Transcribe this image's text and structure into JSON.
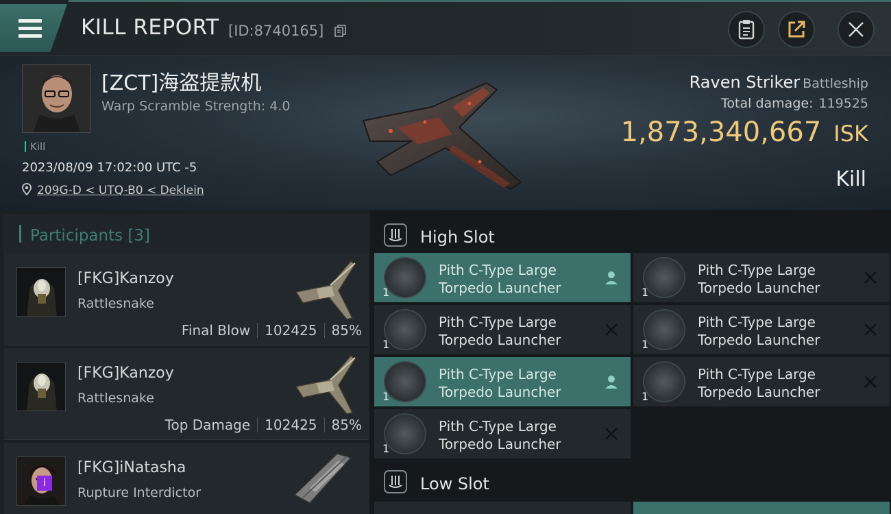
{
  "header": {
    "title": "KILL REPORT",
    "report_id": "[ID:8740165]"
  },
  "victim": {
    "name": "[ZCT]海盗提款机",
    "warp_scramble": "Warp Scramble Strength: 4.0",
    "tag": "Kill",
    "datetime": "2023/08/09 17:02:00 UTC -5",
    "location": "209G-D < UTQ-B0 < Deklein",
    "ship_name": "Raven Striker",
    "ship_class": "Battleship",
    "total_damage_label": "Total damage:",
    "total_damage": "119525",
    "isk_value": "1,873,340,667",
    "isk_unit": "ISK",
    "result": "Kill"
  },
  "participants": {
    "label": "Participants [3]",
    "items": [
      {
        "name": "[FKG]Kanzoy",
        "ship": "Rattlesnake",
        "role": "Final Blow",
        "damage": "102425",
        "percent": "85%"
      },
      {
        "name": "[FKG]Kanzoy",
        "ship": "Rattlesnake",
        "role": "Top Damage",
        "damage": "102425",
        "percent": "85%"
      },
      {
        "name": "[FKG]iNatasha",
        "ship": "Rupture Interdictor",
        "badge": "i"
      }
    ]
  },
  "slots": {
    "high": {
      "label": "High Slot",
      "modules": [
        {
          "name_line1": "Pith C-Type Large",
          "name_line2": "Torpedo Launcher",
          "qty": "1",
          "status": "fitted"
        },
        {
          "name_line1": "Pith C-Type Large",
          "name_line2": "Torpedo Launcher",
          "qty": "1",
          "status": "destroyed"
        },
        {
          "name_line1": "Pith C-Type Large",
          "name_line2": "Torpedo Launcher",
          "qty": "1",
          "status": "destroyed"
        },
        {
          "name_line1": "Pith C-Type Large",
          "name_line2": "Torpedo Launcher",
          "qty": "1",
          "status": "destroyed"
        },
        {
          "name_line1": "Pith C-Type Large",
          "name_line2": "Torpedo Launcher",
          "qty": "1",
          "status": "fitted"
        },
        {
          "name_line1": "Pith C-Type Large",
          "name_line2": "Torpedo Launcher",
          "qty": "1",
          "status": "destroyed"
        },
        {
          "name_line1": "Pith C-Type Large",
          "name_line2": "Torpedo Launcher",
          "qty": "1",
          "status": "destroyed"
        }
      ]
    },
    "low": {
      "label": "Low Slot"
    }
  },
  "colors": {
    "accent_teal": "#3b706b",
    "isk_gold": "#f0c97b",
    "background": "#15191c"
  },
  "icons": [
    "menu-icon",
    "copy-icon",
    "clipboard-icon",
    "share-icon",
    "close-icon",
    "location-pin-icon",
    "slot-icon",
    "dropped-icon",
    "destroyed-icon"
  ]
}
